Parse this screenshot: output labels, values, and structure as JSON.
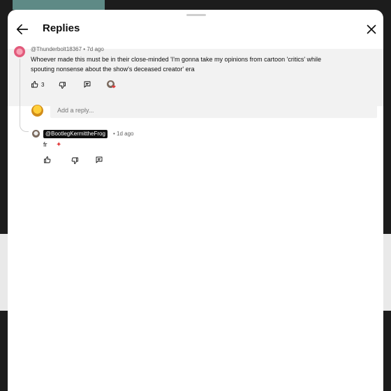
{
  "header": {
    "title": "Replies"
  },
  "comment": {
    "author": "@Thunderbolt18367",
    "time": "7d ago",
    "text_line1": "Whoever made this must be in their close-minded 'I'm gonna take my opinions from cartoon 'critics' while",
    "text_line2": "spouting nonsense about the show's deceased creator' era",
    "like_count": "3"
  },
  "reply_box": {
    "placeholder": "Add a reply..."
  },
  "reply": {
    "author": "@BootlegKermittheFrog",
    "time": "1d ago",
    "text": "fr"
  },
  "icons": [
    "back-arrow-icon",
    "close-icon",
    "thumbs-up-icon",
    "thumbs-down-icon",
    "reply-comment-icon",
    "heart-icon"
  ]
}
